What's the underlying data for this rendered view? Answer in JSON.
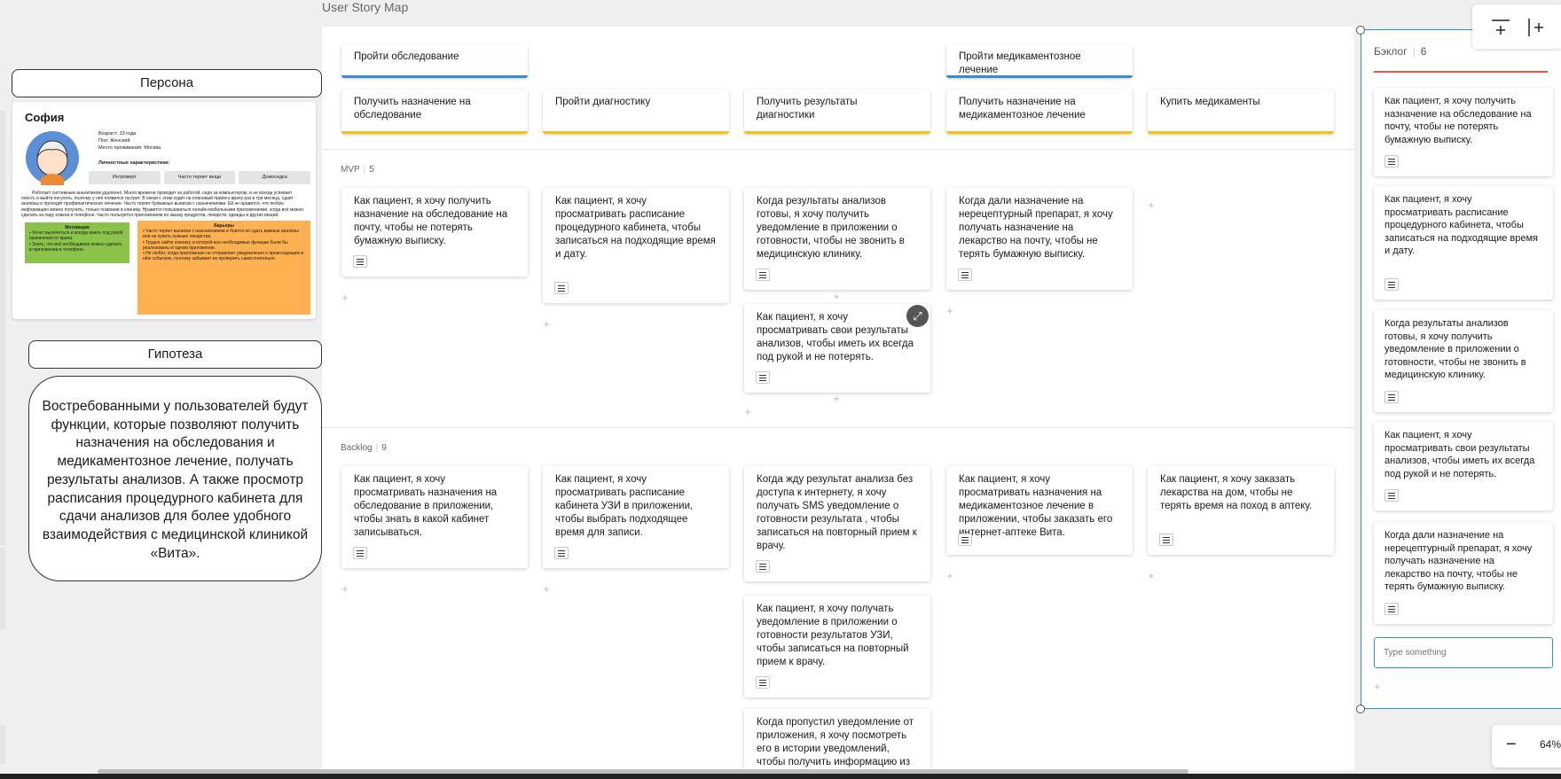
{
  "frame": {
    "title": "User Story Map"
  },
  "sections": {
    "mvp": {
      "label": "MVP",
      "count": "5"
    },
    "backlog": {
      "label": "Backlog",
      "count": "9"
    }
  },
  "activities": [
    "Пройти обследование",
    "Пройти медикаментозное лечение"
  ],
  "steps": [
    "Получить назначение на обследование",
    "Пройти диагностику",
    "Получить результаты диагностики",
    "Получить назначение на медикаментозное лечение",
    "Купить медикаменты"
  ],
  "mvp_stories": [
    "Как пациент, я хочу получить назначение на обследование на почту, чтобы не потерять бумажную выписку.",
    "Как пациент,  я хочу просматривать расписание процедурного кабинета, чтобы записаться на подходящие время и дату.",
    "Когда результаты анализов готовы, я хочу получить уведомление в приложении о готовности, чтобы не звонить в медицинскую клинику.",
    "Как пациент, я хочу просматривать свои результаты анализов, чтобы иметь их всегда под рукой и не потерять.",
    "Когда дали назначение на нерецептурный препарат, я хочу получать назначение на лекарство на почту, чтобы не  терять бумажную выписку."
  ],
  "backlog_stories": [
    "Как пациент, я хочу просматривать назначения на обследование в приложении, чтобы  знать в какой кабинет записываться.",
    "Как пациент, я хочу просматривать расписание кабинета УЗИ в приложении, чтобы выбрать подходящее время для записи.",
    "Когда жду результат анализа без доступа к интернету, я хочу получать SMS уведомление о готовности результата , чтобы записаться на повторный прием к врачу.",
    "Как пациент, я хочу получать уведомление в приложении о готовности результатов УЗИ, чтобы записаться на повторный прием к врачу.",
    "Когда пропустил уведомление от приложения, я хочу посмотреть его в истории уведомлений, чтобы получить информацию из уведомления.",
    "Как пациент, я хочу просматривать назначения на медикаментозное лечение в приложении, чтобы заказать его интернет-аптеке Вита.",
    "Как пациент, я хочу заказать лекарства на дом, чтобы не терять время на поход в аптеку."
  ],
  "persona": {
    "heading": "Персона",
    "name": "София",
    "age": "Возраст: 33 года",
    "gender": "Пол: Женский",
    "city": "Место проживания: Москва",
    "traits_title": "Личностные характеристики:",
    "traits": [
      "Интроверт",
      "Часто теряет вещи",
      "Домоседка"
    ],
    "bio": "Работает системным аналитиком удалённо. Много времени проводит за работой, сидя за компьютером, и не всегда успевает поесть и выйти погулять, поэтому у неё появился гастрит. В связи с этим ходит на плановый приём к врачу раз в три месяца, сдаёт анализы и проходит профилактическое лечение. Часто теряет бумажные выписки с назначениями. Ей не нравится, что любую информацию можно получить, только позвонив в клинику. Нравится пользоваться онлайн-мобильными приложениями, когда всё можно сделать за пару кликов в телефоне. Часто пользуется приложением по заказу продуктов, лекарств, одежды и других вещей.",
    "motivation_title": "Мотивация",
    "motivation": [
      "Хочет вылечиться и всегда иметь под рукой назначения от врача.",
      "Знать, что всё необходимое можно сделать в приложении в телефоне."
    ],
    "barriers_title": "Барьеры",
    "barriers": [
      "Часто теряет выписки с назначениями и боится не сдать важные анализы или не купить нужные лекарства.",
      "Трудно найти клинику, в которой все необходимые функции были бы реализованы в одном приложении.",
      "Не любит, когда приложение не отправляет уведомления о происходящем и нём событиях, поэтому забывает их проверить самостоятельно."
    ]
  },
  "hypothesis": {
    "heading": "Гипотеза",
    "text": "Востребованными у пользователей будут функции, которые позволяют получить назначения на обследования и медикаментозное лечение, получать результаты анализов. А также просмотр расписания процедурного кабинета для сдачи анализов для более удобного взаимодействия с медицинской клиникой «Вита»."
  },
  "backlog_panel": {
    "title": "Бэклог",
    "count": "6",
    "cards": [
      "Как пациент, я хочу получить назначение на обследование на почту, чтобы не потерять бумажную выписку.",
      "Как пациент,  я хочу просматривать расписание процедурного кабинета, чтобы записаться на подходящие время и дату.",
      "Когда результаты анализов готовы, я хочу получить уведомление в приложении о готовности, чтобы не звонить в медицинскую клинику.",
      "Как пациент, я хочу просматривать свои результаты анализов, чтобы иметь их всегда под рукой и не потерять.",
      "Когда дали назначение на нерецептурный препарат, я хочу получать назначение на лекарство на почту, чтобы не  терять бумажную выписку."
    ],
    "input_placeholder": "Type something"
  },
  "zoom": {
    "value": "64%"
  },
  "colors": {
    "activity": "#2f8fd8",
    "step": "#f2c418",
    "motivation": "#8bc34a",
    "barriers": "#ffb050",
    "backlog_accent": "#e8583a"
  }
}
